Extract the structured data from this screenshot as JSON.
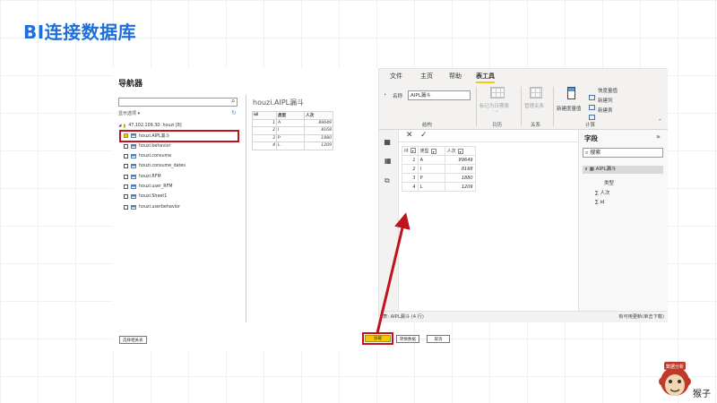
{
  "slide": {
    "title": "BI连接数据库"
  },
  "navigator": {
    "title": "导航器",
    "search_placeholder": "",
    "display_options": "显示选项 ▾",
    "server": "47.102.109.30: houzi [8]",
    "tables": [
      {
        "name": "houzi.AIPL漏斗",
        "checked": true
      },
      {
        "name": "houzi.behavior",
        "checked": false
      },
      {
        "name": "houzi.consume",
        "checked": false
      },
      {
        "name": "houzi.consume_dates",
        "checked": false
      },
      {
        "name": "houzi.RFM",
        "checked": false
      },
      {
        "name": "houzi.user_RFM",
        "checked": false
      },
      {
        "name": "houzi.Sheet1",
        "checked": false
      },
      {
        "name": "houzi.userbehavior",
        "checked": false
      }
    ],
    "preview": {
      "title": "houzi.AIPL漏斗",
      "headers": [
        "id",
        "类型",
        "人次"
      ],
      "rows": [
        [
          "1",
          "A",
          "89649"
        ],
        [
          "2",
          "I",
          "8168"
        ],
        [
          "3",
          "P",
          "1880"
        ],
        [
          "4",
          "L",
          "1209"
        ]
      ]
    },
    "select_related_button": "选择相关表",
    "load_button": "加载",
    "transform_button": "转换数据",
    "cancel_button": "取消"
  },
  "powerbi": {
    "tabs": [
      "文件",
      "主页",
      "帮助",
      "表工具"
    ],
    "active_tab": "表工具",
    "name_label": "名称",
    "name_value": "AIPL漏斗",
    "group_structure": "结构",
    "mark_date_table": "标记为日期表",
    "group_calendar": "日历",
    "manage_relations": "管理关系",
    "group_relations": "关系",
    "new_measure": "新建度量值",
    "quick_measure": "快度量值",
    "new_column": "新建列",
    "new_table": "新建表",
    "group_calc": "计算",
    "table": {
      "headers": [
        "id",
        "类型",
        "人次"
      ],
      "rows": [
        [
          "1",
          "A",
          "89649"
        ],
        [
          "2",
          "I",
          "8168"
        ],
        [
          "3",
          "P",
          "1880"
        ],
        [
          "4",
          "L",
          "1209"
        ]
      ]
    },
    "fields": {
      "title": "字段",
      "collapse": "»",
      "search_placeholder": "搜索",
      "table_name": "AIPL漏斗",
      "items": [
        "类型",
        "人次",
        "id"
      ]
    },
    "status_left": "表: AIPL漏斗 (4 行)",
    "status_right": "有可用更新(单击下载)"
  },
  "logo": {
    "text": "猴子",
    "badge": "数据分析"
  }
}
